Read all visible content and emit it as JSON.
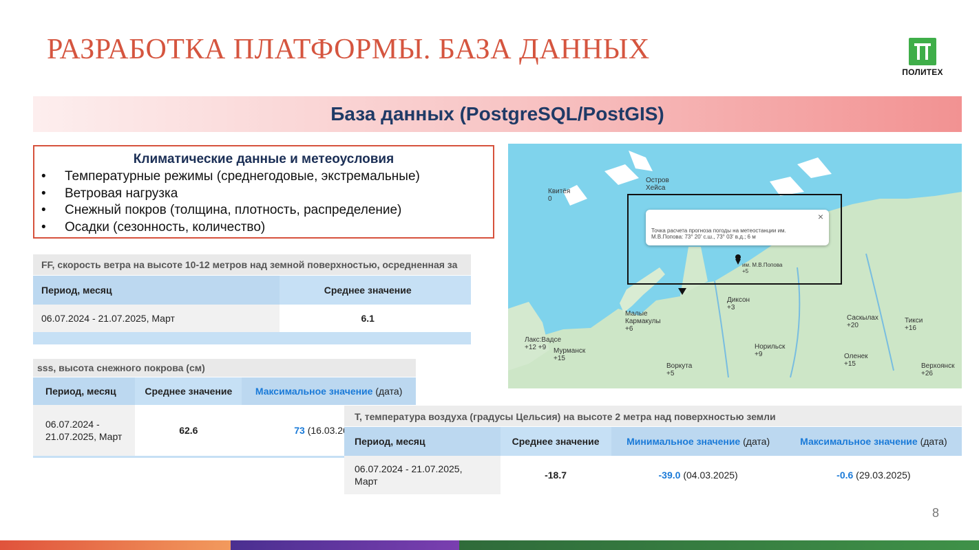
{
  "slide": {
    "title": "РАЗРАБОТКА ПЛАТФОРМЫ. БАЗА ДАННЫХ",
    "page_number": "8",
    "logo_text": "ПОЛИТЕХ",
    "banner": "База данных (PostgreSQL/PostGIS)"
  },
  "climate": {
    "heading": "Климатические данные и метеоусловия",
    "items": [
      "Температурные режимы (среднегодовые, экстремальные)",
      "Ветровая нагрузка",
      "Снежный покров (толщина, плотность, распределение)",
      "Осадки (сезонность, количество)"
    ]
  },
  "wind_table": {
    "caption": "FF, скорость ветра на высоте 10-12 метров над земной поверхностью, осредненная за",
    "headers": [
      "Период, месяц",
      "Среднее значение"
    ],
    "row": [
      "06.07.2024 - 21.07.2025, Март",
      "6.1"
    ]
  },
  "snow_table": {
    "caption": "sss, высота снежного покрова (см)",
    "headers": [
      "Период, месяц",
      "Среднее значение",
      "Максимальное значение",
      "(дата)"
    ],
    "row": [
      "06.07.2024 - 21.07.2025, Март",
      "62.6",
      "73",
      "(16.03.20"
    ]
  },
  "temp_table": {
    "caption": "T, температура воздуха (градусы Цельсия) на высоте 2 метра над поверхностью земли",
    "headers": [
      "Период, месяц",
      "Среднее значение",
      "Минимальное значение",
      "(дата)",
      "Максимальное значение",
      "(дата)"
    ],
    "row": [
      "06.07.2024 - 21.07.2025, Март",
      "-18.7",
      "-39.0",
      "(04.03.2025)",
      "-0.6",
      "(29.03.2025)"
    ]
  },
  "map": {
    "popup_text": "Точка расчета прогноза погоды на метеостанции им. М.В.Попова: 73° 20' с.ш., 73° 03' в.д.; 6 м",
    "labels": [
      {
        "name": "Квитёя",
        "temp": "0"
      },
      {
        "name": "Остров Хейса",
        "temp": ""
      },
      {
        "name": "им. М.В.Попова",
        "temp": "+5"
      },
      {
        "name": "Диксон",
        "temp": "+3"
      },
      {
        "name": "Малые Кармакулы",
        "temp": "+6"
      },
      {
        "name": "Саскылах",
        "temp": "+20"
      },
      {
        "name": "Тикси",
        "temp": "+16"
      },
      {
        "name": "Лакс:Вадсе",
        "temp": "+12 +9"
      },
      {
        "name": "Мурманск",
        "temp": "+15"
      },
      {
        "name": "Норильск",
        "temp": "+9"
      },
      {
        "name": "Оленек",
        "temp": "+15"
      },
      {
        "name": "Верхоянск",
        "temp": "+26"
      },
      {
        "name": "Воркута",
        "temp": "+5"
      }
    ]
  },
  "colors": {
    "title": "#d5553f",
    "banner_text": "#1f3a66",
    "table_header": "#bcd8f0",
    "link_blue": "#1a7ad8",
    "logo_green": "#3fae49"
  }
}
